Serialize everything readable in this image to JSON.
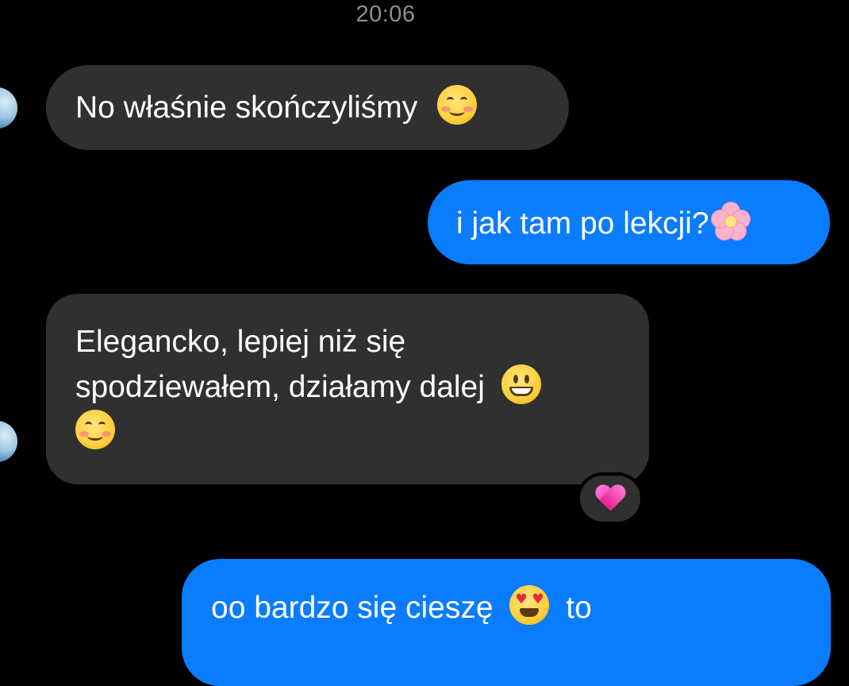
{
  "timestamp": "20:06",
  "messages": [
    {
      "direction": "incoming",
      "text": "No właśnie skończyliśmy",
      "emoji": [
        "smiling-face-icon"
      ]
    },
    {
      "direction": "outgoing",
      "text": "i jak tam po lekcji?",
      "emoji": [
        "cherry-blossom-icon"
      ]
    },
    {
      "direction": "incoming",
      "line1": "Elegancko, lepiej niż się",
      "line2": "spodziewałem, działamy dalej",
      "emoji": [
        "grinning-face-icon",
        "smiling-face-icon"
      ],
      "reaction": "pink-heart-icon"
    },
    {
      "direction": "outgoing",
      "text": "oo bardzo się cieszę",
      "text_after": "to",
      "emoji": [
        "heart-eyes-face-icon"
      ]
    }
  ],
  "colors": {
    "background": "#000000",
    "incoming_bubble": "#303030",
    "outgoing_bubble": "#0a7cff",
    "timestamp": "#8e8e93"
  }
}
